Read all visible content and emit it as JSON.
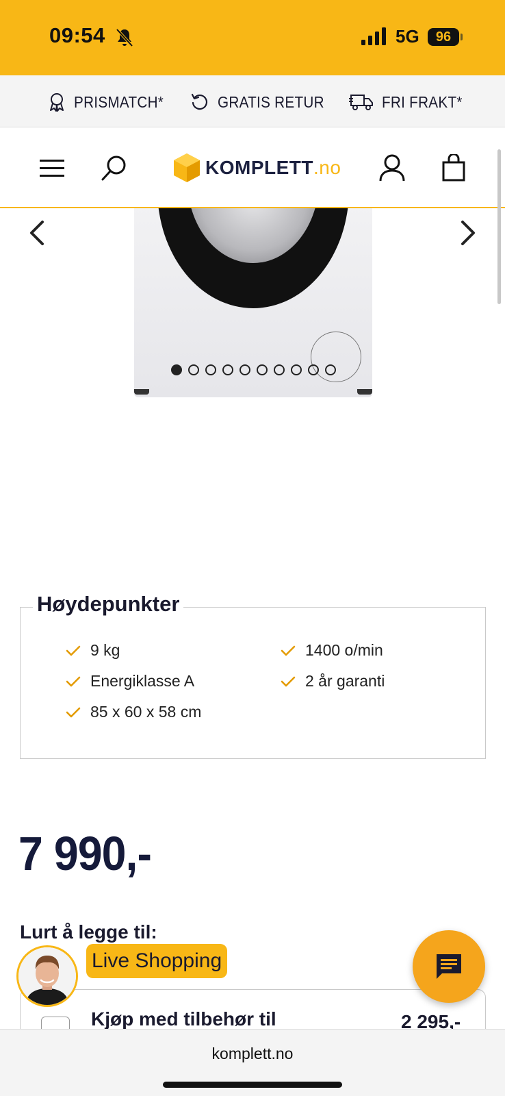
{
  "status_bar": {
    "time": "09:54",
    "network": "5G",
    "battery": "96"
  },
  "usp_bar": {
    "items": [
      {
        "icon": "award-icon",
        "label": "PRISMATCH*"
      },
      {
        "icon": "return-icon",
        "label": "GRATIS RETUR"
      },
      {
        "icon": "truck-icon",
        "label": "FRI FRAKT*"
      }
    ]
  },
  "header": {
    "logo": {
      "brand": "KOMPLETT",
      "suffix": ".no"
    },
    "icons": [
      "menu-icon",
      "search-icon",
      "account-icon",
      "cart-icon"
    ]
  },
  "gallery": {
    "image_count": 10,
    "active_index": 0
  },
  "highlights": {
    "title": "Høydepunkter",
    "items": [
      "9 kg",
      "1400 o/min",
      "Energiklasse A",
      "2 år garanti",
      "85 x 60 x 58 cm"
    ]
  },
  "price": "7 990,-",
  "addon": {
    "title": "Lurt å legge til:",
    "item_label": "Kjøp med tilbehør til",
    "item_price": "2 295,-"
  },
  "live_shopping": {
    "label": "Live Shopping"
  },
  "browser": {
    "url": "komplett.no"
  },
  "colors": {
    "brand_yellow": "#f8b716",
    "brand_navy": "#1c2140",
    "chat_orange": "#f5a51c"
  }
}
